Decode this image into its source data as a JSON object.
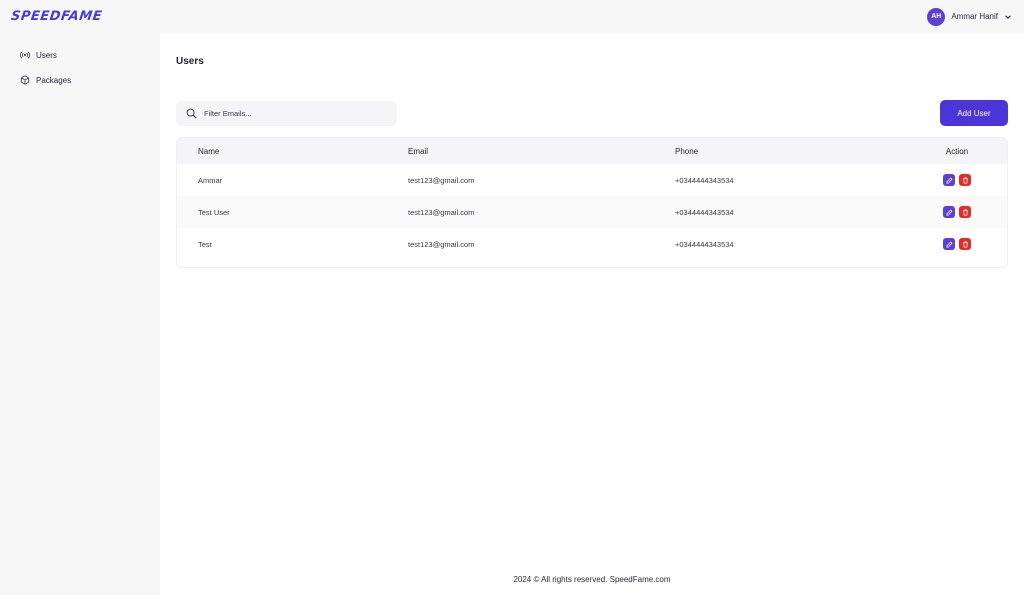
{
  "header": {
    "logo": "SPEEDFAME",
    "user": {
      "initials": "AH",
      "name": "Ammar Hanif"
    }
  },
  "sidebar": {
    "items": [
      {
        "label": "Users",
        "icon": "broadcast-icon"
      },
      {
        "label": "Packages",
        "icon": "package-icon"
      }
    ]
  },
  "main": {
    "title": "Users",
    "search": {
      "placeholder": "Filter Emails...",
      "value": ""
    },
    "add_label": "Add User",
    "table": {
      "columns": [
        "Name",
        "Email",
        "Phone",
        "Action"
      ],
      "rows": [
        {
          "name": "Ammar",
          "email": "test123@gmail.com",
          "phone": "+0344444343534"
        },
        {
          "name": "Test User",
          "email": "test123@gmail.com",
          "phone": "+0344444343534"
        },
        {
          "name": "Test",
          "email": "test123@gmail.com",
          "phone": "+0344444343534"
        }
      ]
    }
  },
  "footer": {
    "text": "2024 © All rights reserved. SpeedFame.com"
  },
  "colors": {
    "accent": "#4b35d6",
    "danger": "#e52b2b",
    "sidebar_bg": "#f7f7f7"
  }
}
